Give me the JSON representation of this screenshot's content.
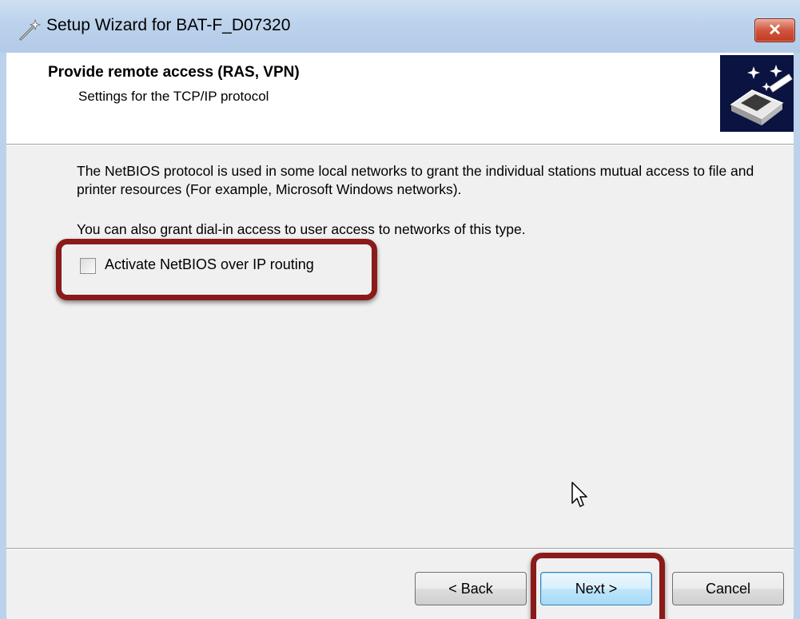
{
  "window": {
    "title": "Setup Wizard for BAT-F_D07320",
    "close_label": "✕"
  },
  "header": {
    "title": "Provide remote access (RAS, VPN)",
    "subtitle": "Settings for the TCP/IP protocol",
    "image_icon": "wizard-network-icon"
  },
  "body": {
    "description": "The NetBIOS protocol is used in some local networks to grant the individual stations mutual access to file and printer resources (For example, Microsoft Windows networks).",
    "description2": "You can also grant dial-in access to user access to networks of this type.",
    "checkbox": {
      "label": "Activate NetBIOS over IP routing",
      "checked": false
    }
  },
  "buttons": {
    "back": "< Back",
    "next": "Next >",
    "cancel": "Cancel"
  },
  "colors": {
    "highlight": "#8b1a1a",
    "titlebar": "#bcd2ec",
    "header_image_bg": "#0b1340"
  }
}
